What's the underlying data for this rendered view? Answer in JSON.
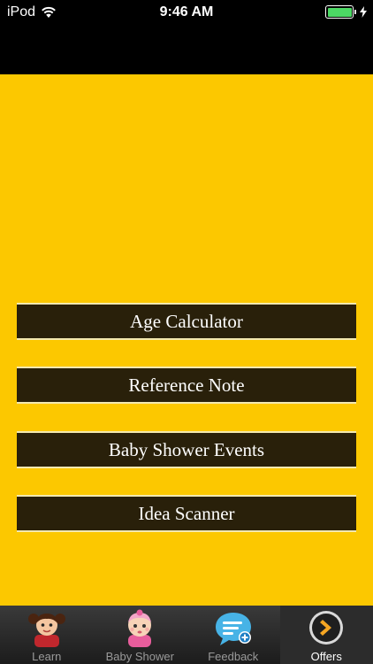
{
  "status_bar": {
    "carrier": "iPod",
    "time": "9:46 AM"
  },
  "menu": {
    "items": [
      {
        "label": "Age Calculator"
      },
      {
        "label": "Reference Note"
      },
      {
        "label": "Baby Shower Events"
      },
      {
        "label": "Idea Scanner"
      }
    ]
  },
  "tab_bar": {
    "tabs": [
      {
        "label": "Learn",
        "icon": "girl-face-icon"
      },
      {
        "label": "Baby Shower",
        "icon": "baby-face-icon"
      },
      {
        "label": "Feedback",
        "icon": "chat-bubble-plus-icon"
      },
      {
        "label": "Offers",
        "icon": "chevron-circle-icon"
      }
    ],
    "active": "Offers"
  },
  "colors": {
    "background": "#fcc800",
    "button": "#29200a",
    "battery": "#4cd964"
  }
}
